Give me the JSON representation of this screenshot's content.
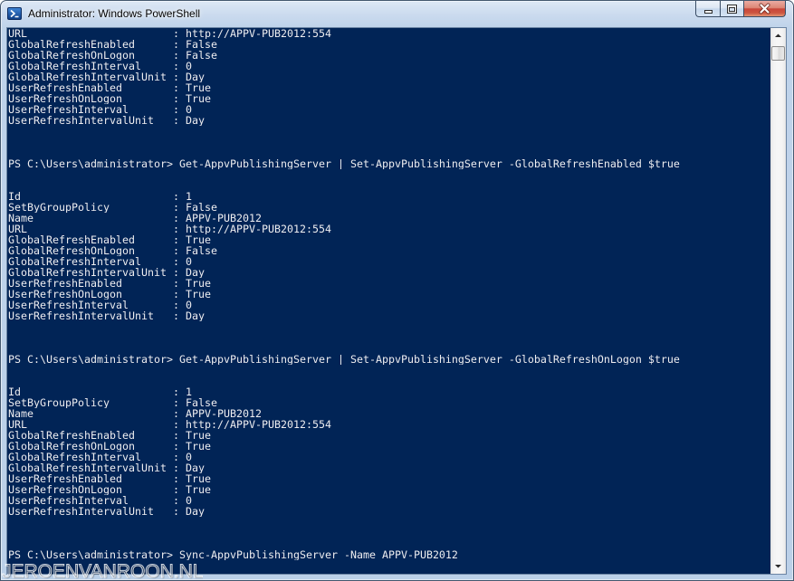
{
  "window": {
    "title": "Administrator: Windows PowerShell",
    "app_icon": "powershell-icon",
    "controls": {
      "minimize_icon": "minimize-icon",
      "maximize_icon": "maximize-icon",
      "close_icon": "close-icon"
    }
  },
  "colors": {
    "console_background": "#012456",
    "console_text": "#EEEDF0"
  },
  "console": {
    "separator": ":",
    "entries": [
      {
        "type": "output",
        "rows": [
          {
            "name": "URL",
            "value": "http://APPV-PUB2012:554"
          },
          {
            "name": "GlobalRefreshEnabled",
            "value": "False"
          },
          {
            "name": "GlobalRefreshOnLogon",
            "value": "False"
          },
          {
            "name": "GlobalRefreshInterval",
            "value": "0"
          },
          {
            "name": "GlobalRefreshIntervalUnit",
            "value": "Day"
          },
          {
            "name": "UserRefreshEnabled",
            "value": "True"
          },
          {
            "name": "UserRefreshOnLogon",
            "value": "True"
          },
          {
            "name": "UserRefreshInterval",
            "value": "0"
          },
          {
            "name": "UserRefreshIntervalUnit",
            "value": "Day"
          }
        ]
      },
      {
        "type": "command",
        "prompt": "PS C:\\Users\\administrator>",
        "command": "Get-AppvPublishingServer | Set-AppvPublishingServer -GlobalRefreshEnabled $true"
      },
      {
        "type": "output",
        "rows": [
          {
            "name": "Id",
            "value": "1"
          },
          {
            "name": "SetByGroupPolicy",
            "value": "False"
          },
          {
            "name": "Name",
            "value": "APPV-PUB2012"
          },
          {
            "name": "URL",
            "value": "http://APPV-PUB2012:554"
          },
          {
            "name": "GlobalRefreshEnabled",
            "value": "True"
          },
          {
            "name": "GlobalRefreshOnLogon",
            "value": "False"
          },
          {
            "name": "GlobalRefreshInterval",
            "value": "0"
          },
          {
            "name": "GlobalRefreshIntervalUnit",
            "value": "Day"
          },
          {
            "name": "UserRefreshEnabled",
            "value": "True"
          },
          {
            "name": "UserRefreshOnLogon",
            "value": "True"
          },
          {
            "name": "UserRefreshInterval",
            "value": "0"
          },
          {
            "name": "UserRefreshIntervalUnit",
            "value": "Day"
          }
        ]
      },
      {
        "type": "command",
        "prompt": "PS C:\\Users\\administrator>",
        "command": "Get-AppvPublishingServer | Set-AppvPublishingServer -GlobalRefreshOnLogon $true"
      },
      {
        "type": "output",
        "rows": [
          {
            "name": "Id",
            "value": "1"
          },
          {
            "name": "SetByGroupPolicy",
            "value": "False"
          },
          {
            "name": "Name",
            "value": "APPV-PUB2012"
          },
          {
            "name": "URL",
            "value": "http://APPV-PUB2012:554"
          },
          {
            "name": "GlobalRefreshEnabled",
            "value": "True"
          },
          {
            "name": "GlobalRefreshOnLogon",
            "value": "True"
          },
          {
            "name": "GlobalRefreshInterval",
            "value": "0"
          },
          {
            "name": "GlobalRefreshIntervalUnit",
            "value": "Day"
          },
          {
            "name": "UserRefreshEnabled",
            "value": "True"
          },
          {
            "name": "UserRefreshOnLogon",
            "value": "True"
          },
          {
            "name": "UserRefreshInterval",
            "value": "0"
          },
          {
            "name": "UserRefreshIntervalUnit",
            "value": "Day"
          }
        ]
      },
      {
        "type": "command",
        "prompt": "PS C:\\Users\\administrator>",
        "command": "Sync-AppvPublishingServer -Name APPV-PUB2012"
      }
    ]
  },
  "scrollbar": {
    "scrolled_fraction": 0.005,
    "up_icon": "arrow-up-icon",
    "down_icon": "arrow-down-icon"
  },
  "watermark": {
    "text": "JEROENVANROON.NL"
  }
}
